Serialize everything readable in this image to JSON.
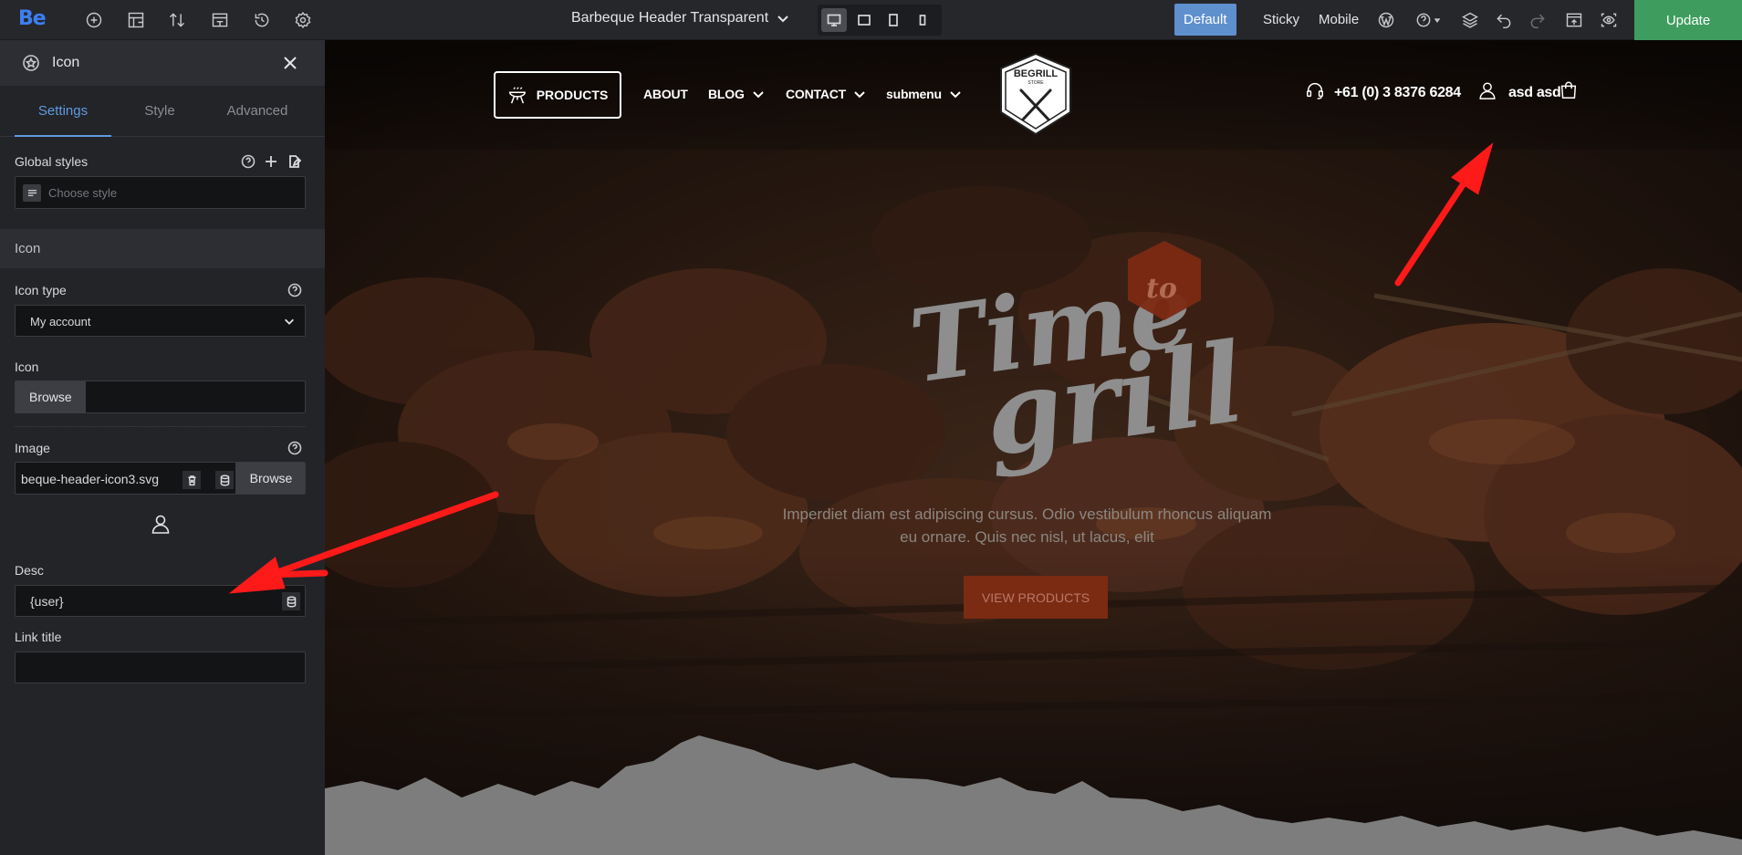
{
  "app": {
    "logo": "Be"
  },
  "topbar": {
    "page_title": "Barbeque Header Transparent",
    "modes": [
      "Default",
      "Sticky",
      "Mobile"
    ],
    "update_label": "Update"
  },
  "panel": {
    "title": "Icon",
    "tabs": [
      "Settings",
      "Style",
      "Advanced"
    ],
    "global_styles_label": "Global styles",
    "choose_style_placeholder": "Choose style",
    "section_title": "Icon",
    "icon_type_label": "Icon type",
    "icon_type_value": "My account",
    "icon_label": "Icon",
    "browse_label": "Browse",
    "image_label": "Image",
    "image_value": "beque-header-icon3.svg",
    "desc_label": "Desc",
    "desc_value": "{user}",
    "link_title_label": "Link title",
    "link_title_value": ""
  },
  "preview": {
    "nav": {
      "products": "PRODUCTS",
      "about": "ABOUT",
      "blog": "BLOG",
      "contact": "CONTACT",
      "submenu": "submenu"
    },
    "logo_text": "BEGRILL",
    "logo_subtext": "STORE",
    "phone": "+61 (0) 3 8376 6284",
    "user_label": "asd asd",
    "hero_script_time": "Time",
    "hero_script_to": "to",
    "hero_script_grill": "grill",
    "hero_text_line1": "Imperdiet diam est adipiscing cursus. Odio vestibulum rhoncus aliquam",
    "hero_text_line2": "eu ornare. Quis nec nisl, ut lacus, elit",
    "hero_button": "VIEW PRODUCTS"
  },
  "colors": {
    "accent_blue": "#5f9ae0",
    "update_green": "#3e9d5e",
    "annotation_red": "#ff1a1a",
    "hero_button": "#7a2b12"
  }
}
